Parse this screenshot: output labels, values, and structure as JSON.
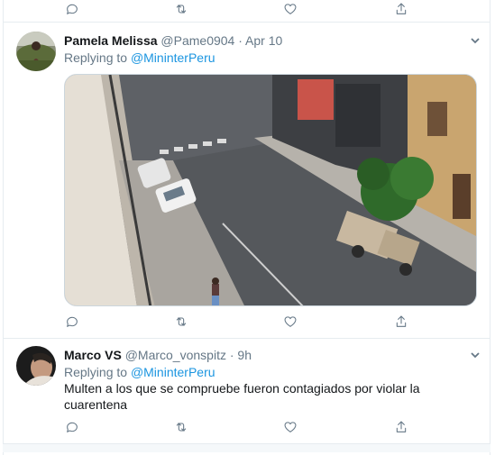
{
  "colors": {
    "link": "#1b95e0",
    "muted": "#657786",
    "text": "#14171a",
    "border": "#e6ecf0"
  },
  "icons": {
    "reply": "reply-icon",
    "retweet": "retweet-icon",
    "like": "heart-icon",
    "share": "share-icon",
    "caret": "chevron-down-icon"
  },
  "tweets": [
    {
      "name": "Pamela Melissa",
      "handle": "@Pame0904",
      "dot": "·",
      "time": "Apr 10",
      "replying_prefix": "Replying to",
      "replying_to": "@MininterPeru",
      "text": "",
      "media": "street-photo"
    },
    {
      "name": "Marco VS",
      "handle": "@Marco_vonspitz",
      "dot": "·",
      "time": "9h",
      "replying_prefix": "Replying to",
      "replying_to": "@MininterPeru",
      "text": "Multen a los que se compruebe fueron contagiados por violar la cuarentena"
    }
  ]
}
